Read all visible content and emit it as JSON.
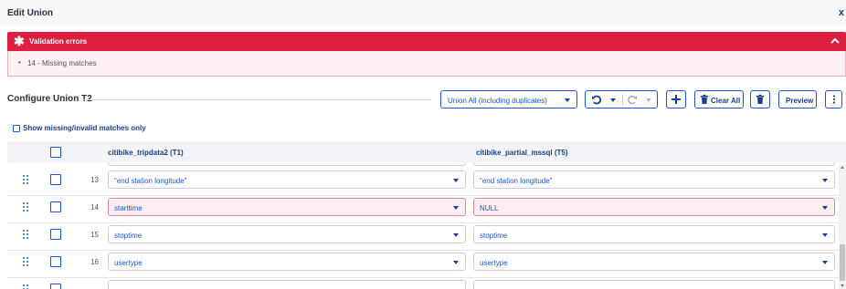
{
  "dialog": {
    "title": "Edit Union",
    "close_label": "x"
  },
  "validation": {
    "title": "Validation errors",
    "icon": "asterisk-icon",
    "items": [
      "14 - Missing matches"
    ]
  },
  "configure": {
    "title": "Configure Union T2",
    "union_type": "Union All (including duplicates)",
    "clear_all_label": "Clear All",
    "preview_label": "Preview"
  },
  "filter": {
    "show_missing_label": "Show missing/invalid matches only"
  },
  "columns": [
    "citibike_tripdata2 (T1)",
    "citibike_partial_mssql (T5)"
  ],
  "rows": [
    {
      "num": "13",
      "left": "\"end station longitude\"",
      "right": "\"end station longitude\"",
      "error": false
    },
    {
      "num": "14",
      "left": "starttime",
      "right": "NULL",
      "error": true
    },
    {
      "num": "15",
      "left": "stoptime",
      "right": "stoptime",
      "error": false
    },
    {
      "num": "16",
      "left": "usertype",
      "right": "usertype",
      "error": false
    }
  ],
  "colors": {
    "accent": "#1a56db",
    "error": "#dc1f3f",
    "error_bg": "#fdf1f3"
  }
}
